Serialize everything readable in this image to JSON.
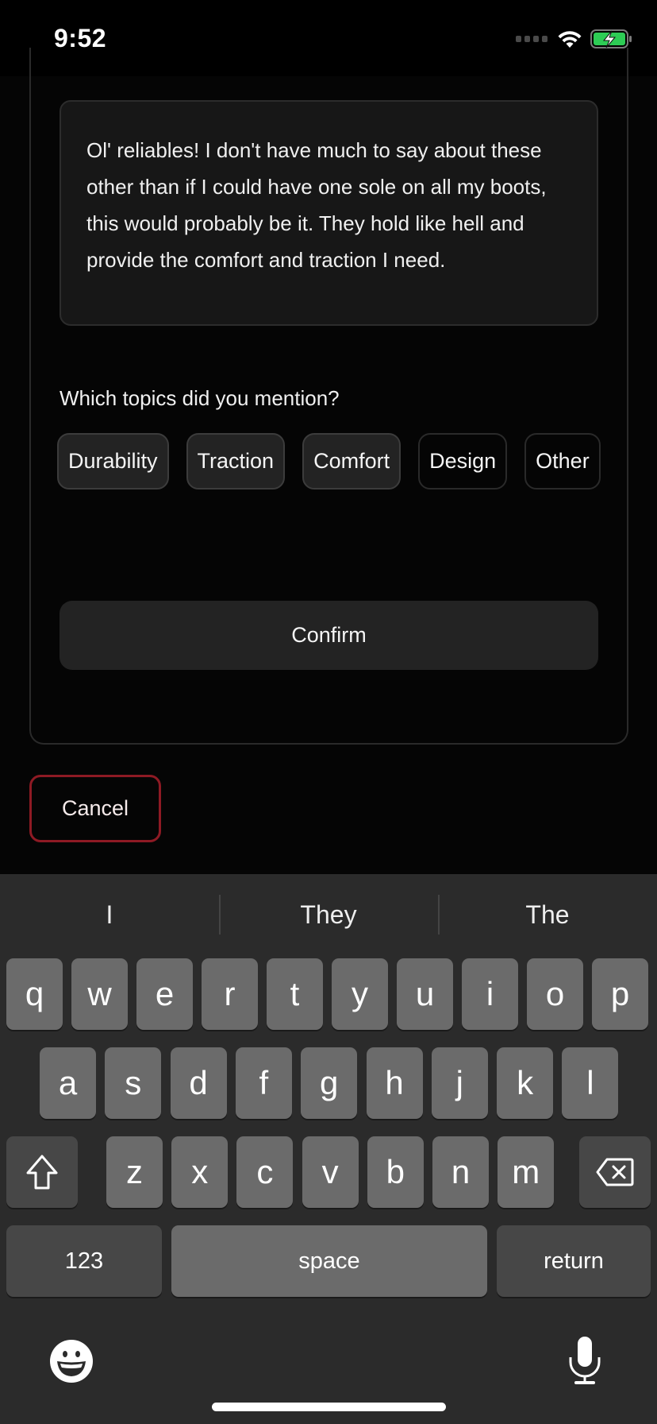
{
  "status_bar": {
    "time": "9:52",
    "icons": [
      "signal-icon",
      "wifi-icon",
      "battery-charging-icon"
    ],
    "battery_color": "#2ecc55"
  },
  "review": {
    "text": "Ol' reliables! I don't have much to say about these other than if I could have one sole on all my boots, this would probably be it. They hold like hell and provide the comfort and traction I need."
  },
  "topics": {
    "question": "Which topics did you mention?",
    "chips": [
      {
        "label": "Durability",
        "selected": true
      },
      {
        "label": "Traction",
        "selected": true
      },
      {
        "label": "Comfort",
        "selected": true
      },
      {
        "label": "Design",
        "selected": false
      },
      {
        "label": "Other",
        "selected": false
      }
    ]
  },
  "actions": {
    "confirm_label": "Confirm",
    "cancel_label": "Cancel",
    "cancel_border_color": "#8e1a24"
  },
  "keyboard": {
    "suggestions": [
      "I",
      "They",
      "The"
    ],
    "row1": [
      "q",
      "w",
      "e",
      "r",
      "t",
      "y",
      "u",
      "i",
      "o",
      "p"
    ],
    "row2": [
      "a",
      "s",
      "d",
      "f",
      "g",
      "h",
      "j",
      "k",
      "l"
    ],
    "row3": [
      "z",
      "x",
      "c",
      "v",
      "b",
      "n",
      "m"
    ],
    "numbers_label": "123",
    "space_label": "space",
    "return_label": "return",
    "icons": [
      "shift-icon",
      "backspace-icon",
      "emoji-icon",
      "microphone-icon"
    ]
  }
}
